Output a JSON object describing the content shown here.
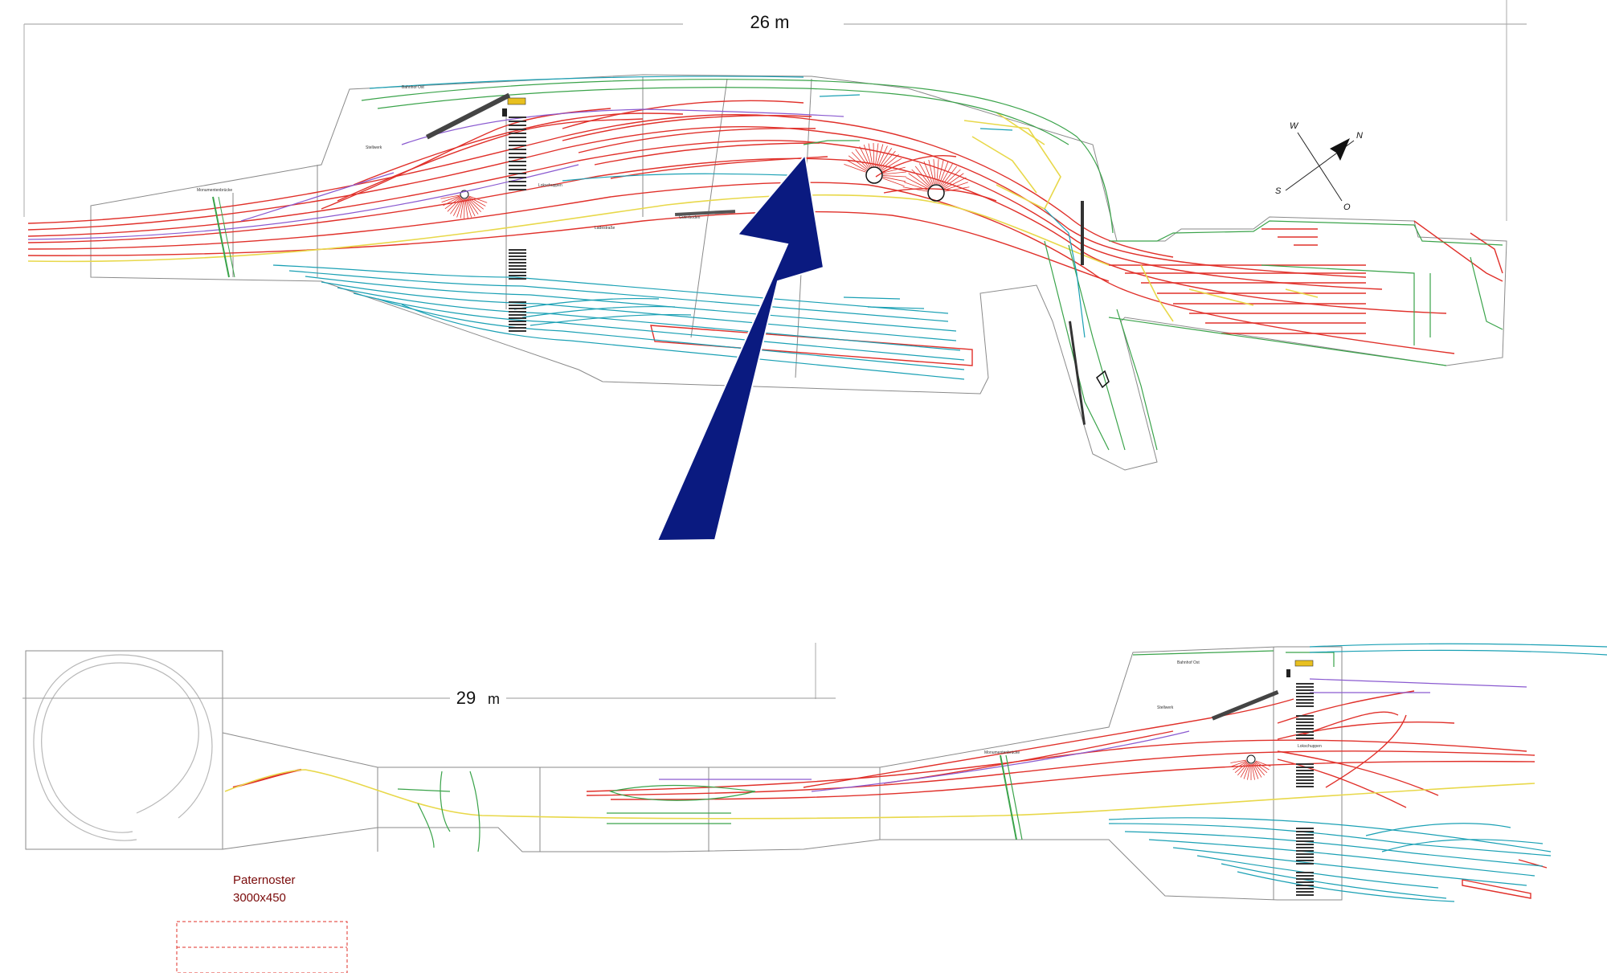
{
  "top_plan": {
    "dimension_label": "26 m",
    "labels": {
      "bridge": "Monumentenbrücke",
      "station_top": "Bahnhof Ost",
      "yard": "Lokschuppen",
      "small_a": "Stellwerk",
      "small_b": "Güterboden",
      "small_c": "Ladestraße"
    }
  },
  "bottom_plan": {
    "dimension_value": "29",
    "dimension_unit": "m",
    "labels": {
      "bridge": "Monumentenbrücke",
      "station_top": "Bahnhof Ost",
      "yard": "Lokschuppen",
      "small_a": "Stellwerk"
    }
  },
  "compass": {
    "w": "W",
    "n": "N",
    "s": "S",
    "o": "O"
  },
  "paternoster": {
    "title": "Paternoster",
    "size": "3000x450"
  },
  "colors": {
    "track_main": "#e0302a",
    "track_yard": "#1aa0b4",
    "track_green": "#3aa34a",
    "track_yellow": "#e8d84a",
    "track_purple": "#8a5ad0",
    "outline": "#8a8a8a",
    "arrow": "#0a1a80"
  }
}
